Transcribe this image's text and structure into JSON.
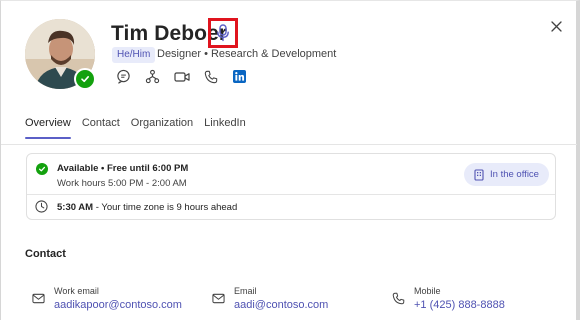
{
  "profile": {
    "name": "Tim Deboer",
    "pronouns": "He/Him",
    "subtitle": "Designer • Research & Development",
    "presence": "available"
  },
  "quick_actions": [
    "chat-icon",
    "org-chart-icon",
    "video-call-icon",
    "phone-icon",
    "linkedin-icon"
  ],
  "tabs": [
    {
      "label": "Overview",
      "active": true
    },
    {
      "label": "Contact",
      "active": false
    },
    {
      "label": "Organization",
      "active": false
    },
    {
      "label": "LinkedIn",
      "active": false
    }
  ],
  "availability": {
    "status": "Available • Free until 6:00 PM",
    "work_hours": "Work hours 5:00 PM - 2:00 AM",
    "local_time": "5:30 AM",
    "time_note": " - Your time zone is 9 hours ahead",
    "location": "In the office"
  },
  "contact": {
    "title": "Contact",
    "items": [
      {
        "label": "Work email",
        "value": "aadikapoor@contoso.com",
        "icon": "mail-icon"
      },
      {
        "label": "Email",
        "value": "aadi@contoso.com",
        "icon": "mail-icon"
      },
      {
        "label": "Mobile",
        "value": "+1 (425) 888-8888",
        "icon": "phone-icon"
      }
    ]
  },
  "colors": {
    "accent": "#5b5fc7",
    "link": "#4f52b2",
    "presence_green": "#13a10e",
    "highlight_red": "#e0141e"
  }
}
